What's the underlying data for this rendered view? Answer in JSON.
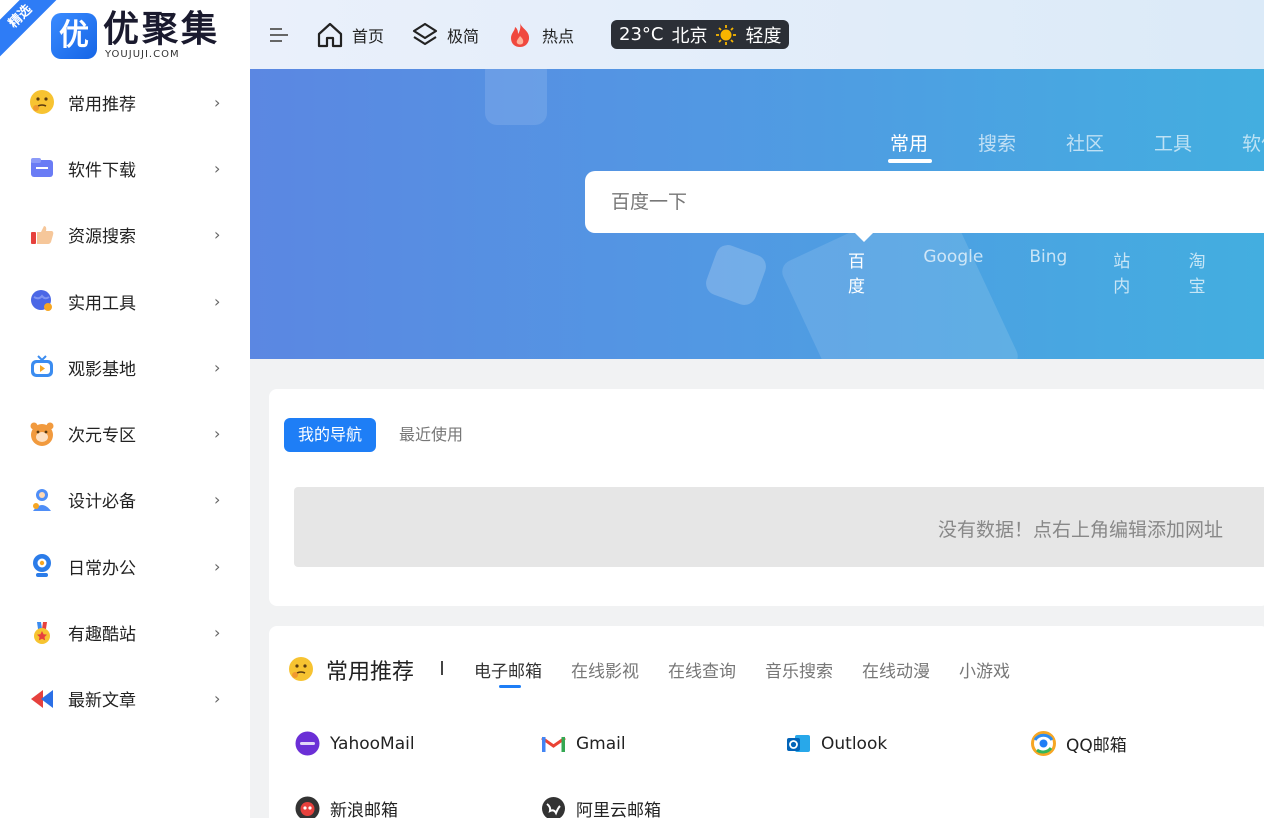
{
  "brand": {
    "ribbon": "精选",
    "mark": "优",
    "name": "优聚集",
    "domain": "YOUJUJI.COM",
    "accent": "#1e7ef6"
  },
  "sidebar": {
    "items": [
      {
        "label": "常用推荐",
        "icon": "thinking-emoji-icon"
      },
      {
        "label": "软件下载",
        "icon": "folder-icon"
      },
      {
        "label": "资源搜索",
        "icon": "thumbs-up-icon"
      },
      {
        "label": "实用工具",
        "icon": "globe-icon"
      },
      {
        "label": "观影基地",
        "icon": "tv-icon"
      },
      {
        "label": "次元专区",
        "icon": "bear-face-icon"
      },
      {
        "label": "设计必备",
        "icon": "designer-icon"
      },
      {
        "label": "日常办公",
        "icon": "webcam-icon"
      },
      {
        "label": "有趣酷站",
        "icon": "medal-icon"
      },
      {
        "label": "最新文章",
        "icon": "arrows-icon"
      }
    ],
    "chevron": "›"
  },
  "topbar": {
    "links": [
      {
        "label": "首页",
        "icon": "home-icon"
      },
      {
        "label": "极简",
        "icon": "layers-icon"
      },
      {
        "label": "热点",
        "icon": "fire-icon"
      }
    ],
    "weather": {
      "temp": "23°C",
      "city": "北京",
      "icon": "sun-icon",
      "air": "轻度"
    }
  },
  "search": {
    "categories": [
      "常用",
      "搜索",
      "社区",
      "工具",
      "软件"
    ],
    "active_category": "常用",
    "placeholder": "百度一下",
    "engines": [
      "百度",
      "Google",
      "Bing",
      "站内",
      "淘宝"
    ],
    "active_engine": "百度"
  },
  "my_nav": {
    "tabs": [
      "我的导航",
      "最近使用"
    ],
    "empty_text": "没有数据！点右上角编辑添加网址"
  },
  "recommend": {
    "title": "常用推荐",
    "tabs": [
      "电子邮箱",
      "在线影视",
      "在线查询",
      "音乐搜索",
      "在线动漫",
      "小游戏"
    ],
    "active_tab": "电子邮箱",
    "sites": [
      {
        "label": "YahooMail",
        "icon": "yahoo-icon"
      },
      {
        "label": "Gmail",
        "icon": "gmail-icon"
      },
      {
        "label": "Outlook",
        "icon": "outlook-icon"
      },
      {
        "label": "QQ邮箱",
        "icon": "qq-mail-icon"
      },
      {
        "label": "新浪邮箱",
        "icon": "sina-icon"
      },
      {
        "label": "阿里云邮箱",
        "icon": "aliyun-icon"
      }
    ]
  }
}
